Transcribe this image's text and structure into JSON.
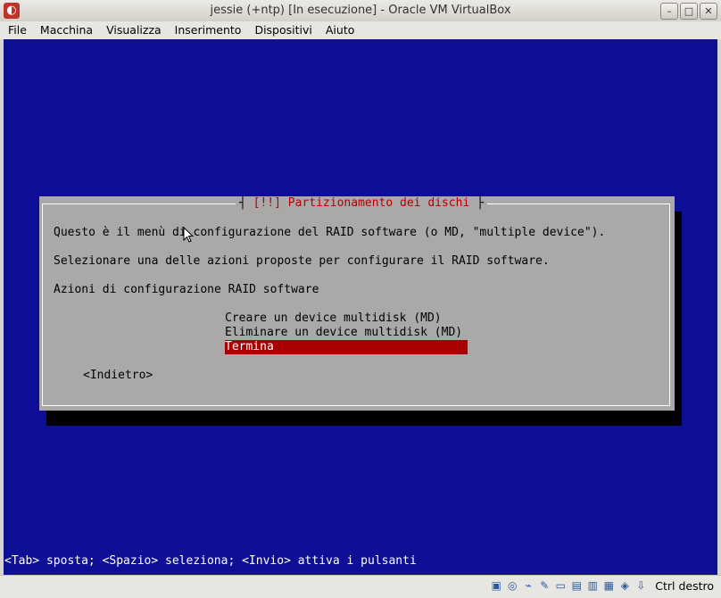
{
  "window": {
    "title": "jessie (+ntp) [In esecuzione] - Oracle VM VirtualBox",
    "controls": [
      "minimize",
      "maximize",
      "close"
    ]
  },
  "menubar": {
    "items": [
      "File",
      "Macchina",
      "Visualizza",
      "Inserimento",
      "Dispositivi",
      "Aiuto"
    ]
  },
  "dialog": {
    "title_left": "[!!]",
    "title": "Partizionamento dei dischi",
    "line1": "Questo è il menù di configurazione del RAID software (o MD, \"multiple device\").",
    "line2": "Selezionare una delle azioni proposte per configurare il RAID software.",
    "line3": "Azioni di configurazione RAID software",
    "options": [
      {
        "label": "Creare un device multidisk (MD)",
        "selected": false
      },
      {
        "label": "Eliminare un device multidisk (MD)",
        "selected": false
      },
      {
        "label": "Termina",
        "selected": true
      }
    ],
    "back_button": "<Indietro>"
  },
  "footer": "<Tab> sposta; <Spazio> seleziona; <Invio> attiva i pulsanti",
  "statusbar": {
    "icons": [
      "hard-disk-icon",
      "optical-drive-icon",
      "usb-icon",
      "shared-folder-icon",
      "display-icon",
      "network-icon",
      "video-capture-icon",
      "vt-x-icon",
      "mouse-integration-icon",
      "arrow-down-icon"
    ],
    "host_key": "Ctrl destro"
  },
  "colors": {
    "screen_bg": "#0f0f96",
    "dialog_bg": "#aaa9a7",
    "selection": "#a80000",
    "title_text": "#b40000"
  }
}
